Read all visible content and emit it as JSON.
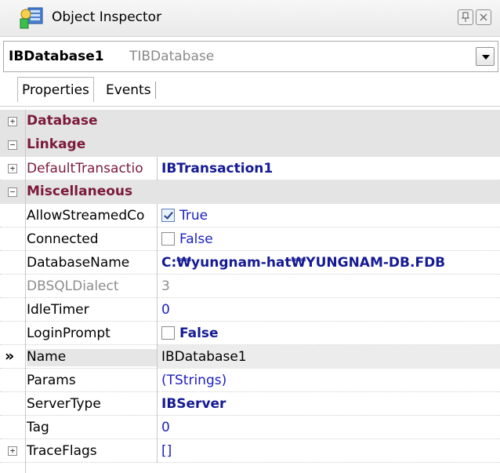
{
  "window": {
    "title": "Object Inspector",
    "pin_icon": "pin-icon",
    "close_icon": "close-icon"
  },
  "object_selector": {
    "name": "IBDatabase1",
    "type": "TIBDatabase"
  },
  "tabs": [
    {
      "label": "Properties",
      "active": true
    },
    {
      "label": "Events",
      "active": false
    }
  ],
  "categories": {
    "database": "Database",
    "linkage": "Linkage",
    "misc": "Miscellaneous"
  },
  "linkage_prop": {
    "name": "DefaultTransactio",
    "value": "IBTransaction1"
  },
  "props": {
    "allow": {
      "name": "AllowStreamedCo",
      "value": "True"
    },
    "connected": {
      "name": "Connected",
      "value": "False"
    },
    "dbname": {
      "name": "DatabaseName",
      "value": "C:₩yungnam-hat₩YUNGNAM-DB.FDB"
    },
    "dialect": {
      "name": "DBSQLDialect",
      "value": "3"
    },
    "idle": {
      "name": "IdleTimer",
      "value": "0"
    },
    "login": {
      "name": "LoginPrompt",
      "value": "False"
    },
    "name": {
      "name": "Name",
      "value": "IBDatabase1"
    },
    "params": {
      "name": "Params",
      "value": "(TStrings)"
    },
    "servertype": {
      "name": "ServerType",
      "value": "IBServer"
    },
    "tag": {
      "name": "Tag",
      "value": "0"
    },
    "traceflags": {
      "name": "TraceFlags",
      "value": "[]"
    }
  },
  "selection_marker": "»",
  "colors": {
    "category_text": "#7b1a3a",
    "value_blue": "#151a93"
  }
}
